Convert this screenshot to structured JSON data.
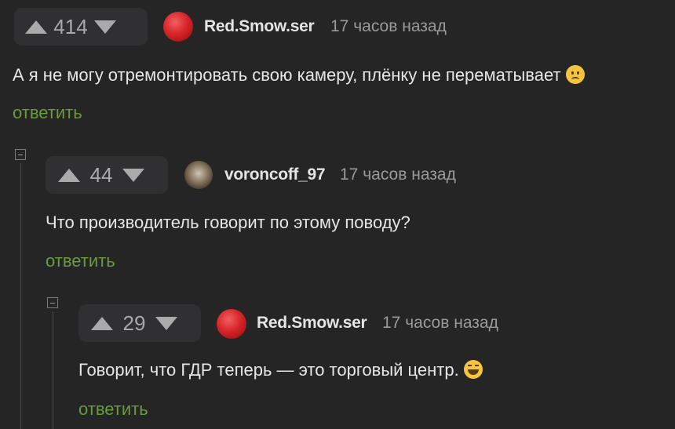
{
  "comments": [
    {
      "score": "414",
      "username": "Red.Smow.ser",
      "time": "17 часов назад",
      "text": "А я не могу отремонтировать свою камеру, плёнку не перематывает",
      "emoji": "sad-face-emoji",
      "reply": "ответить"
    },
    {
      "score": "44",
      "username": "voroncoff_97",
      "time": "17 часов назад",
      "text": "Что производитель говорит по этому поводу?",
      "reply": "ответить"
    },
    {
      "score": "29",
      "username": "Red.Smow.ser",
      "time": "17 часов назад",
      "text": "Говорит, что ГДР теперь — это торговый центр.",
      "emoji": "rolling-laughing-emoji",
      "reply": "ответить"
    }
  ],
  "colors": {
    "background": "#252526",
    "reply_link": "#6a9a3e",
    "vote_box": "#303032"
  }
}
